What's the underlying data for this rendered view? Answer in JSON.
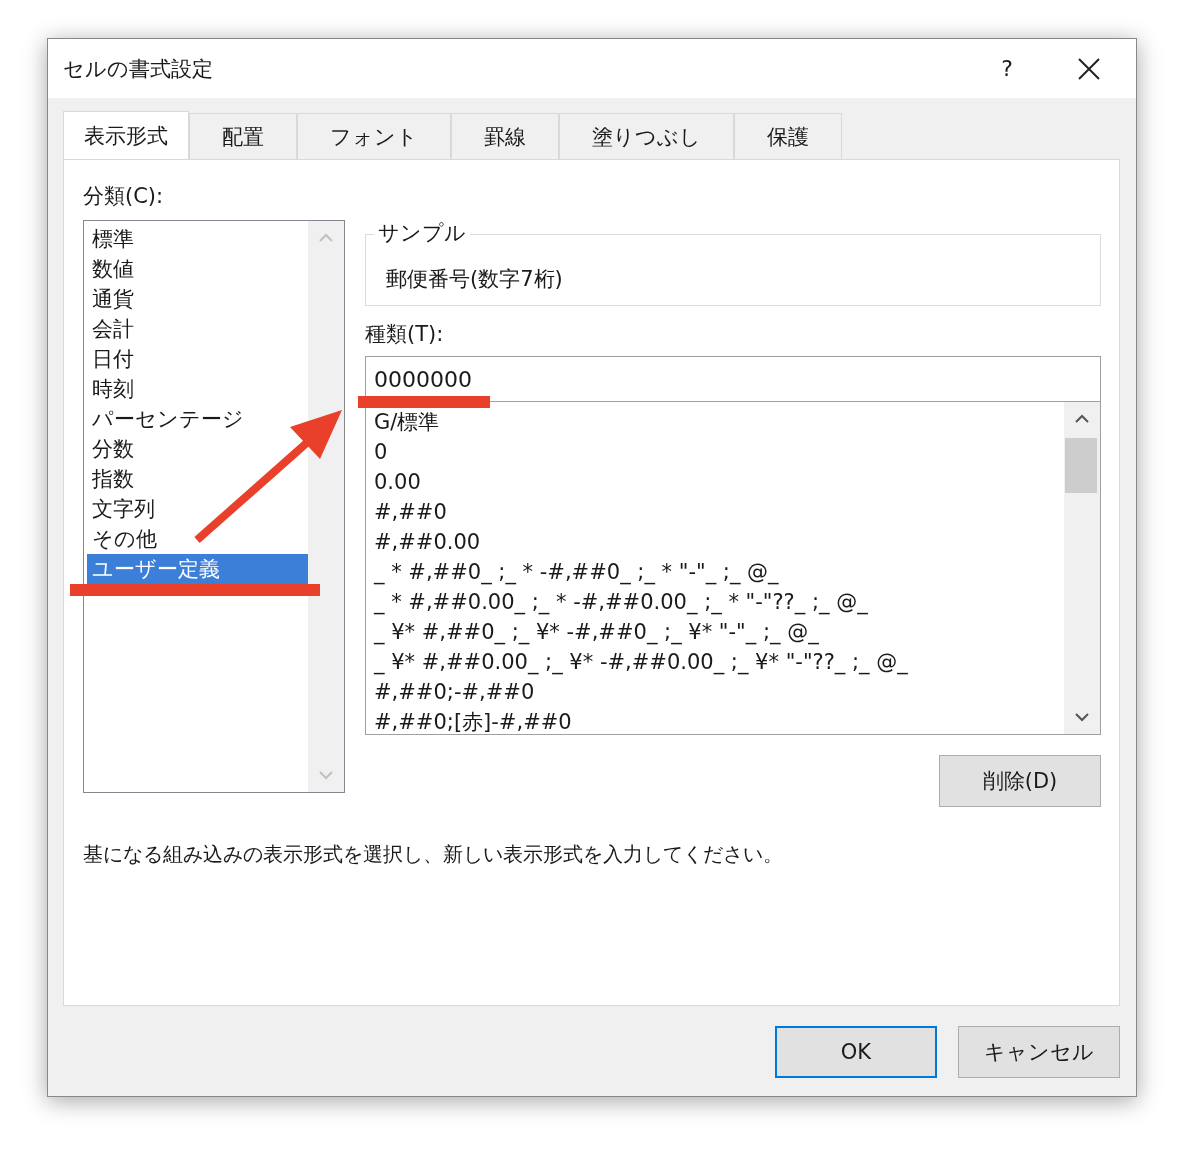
{
  "window": {
    "title": "セルの書式設定",
    "help_button": "?"
  },
  "tabs": [
    {
      "label": "表示形式",
      "selected": true
    },
    {
      "label": "配置",
      "selected": false
    },
    {
      "label": "フォント",
      "selected": false
    },
    {
      "label": "罫線",
      "selected": false
    },
    {
      "label": "塗りつぶし",
      "selected": false
    },
    {
      "label": "保護",
      "selected": false
    }
  ],
  "category_label": "分類(C):",
  "categories": [
    {
      "label": "標準",
      "selected": false
    },
    {
      "label": "数値",
      "selected": false
    },
    {
      "label": "通貨",
      "selected": false
    },
    {
      "label": "会計",
      "selected": false
    },
    {
      "label": "日付",
      "selected": false
    },
    {
      "label": "時刻",
      "selected": false
    },
    {
      "label": "パーセンテージ",
      "selected": false
    },
    {
      "label": "分数",
      "selected": false
    },
    {
      "label": "指数",
      "selected": false
    },
    {
      "label": "文字列",
      "selected": false
    },
    {
      "label": "その他",
      "selected": false
    },
    {
      "label": "ユーザー定義",
      "selected": true
    }
  ],
  "sample": {
    "label": "サンプル",
    "value": "郵便番号(数字7桁)"
  },
  "type_label": "種類(T):",
  "type_field": {
    "value": "0000000"
  },
  "formats": [
    "G/標準",
    "0",
    "0.00",
    "#,##0",
    "#,##0.00",
    "_ * #,##0_ ;_ * -#,##0_ ;_ * \"-\"_ ;_ @_",
    "_ * #,##0.00_ ;_ * -#,##0.00_ ;_ * \"-\"??_ ;_ @_",
    "_ ¥* #,##0_ ;_ ¥* -#,##0_ ;_ ¥* \"-\"_ ;_ @_",
    "_ ¥* #,##0.00_ ;_ ¥* -#,##0.00_ ;_ ¥* \"-\"??_ ;_ @_",
    "#,##0;-#,##0",
    "#,##0;[赤]-#,##0"
  ],
  "delete_button": "削除(D)",
  "description": "基になる組み込みの表示形式を選択し、新しい表示形式を入力してください。",
  "buttons": [
    {
      "label": "OK",
      "default": true
    },
    {
      "label": "キャンセル",
      "default": false
    }
  ]
}
